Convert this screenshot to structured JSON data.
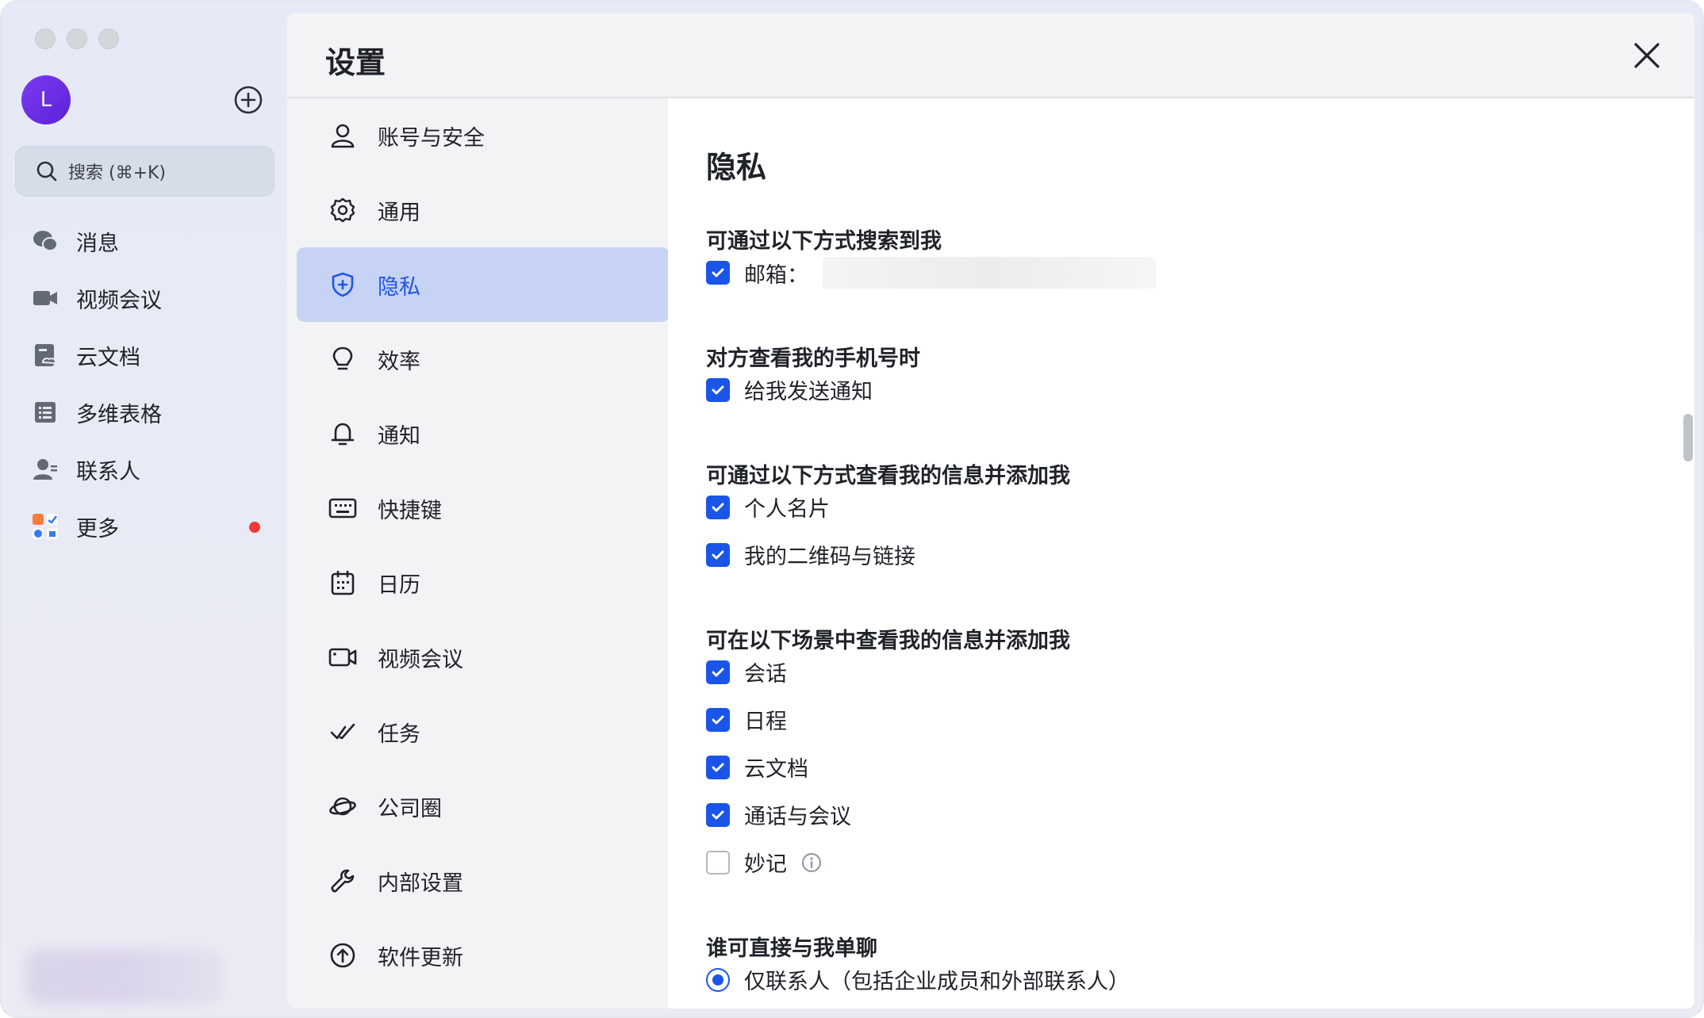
{
  "app": {
    "avatar_letter": "L",
    "search_placeholder": "搜索 (⌘+K)",
    "nav": [
      {
        "label": "消息",
        "icon": "chat-bubble-icon"
      },
      {
        "label": "视频会议",
        "icon": "video-camera-icon"
      },
      {
        "label": "云文档",
        "icon": "cloud-doc-icon"
      },
      {
        "label": "多维表格",
        "icon": "table-grid-icon"
      },
      {
        "label": "联系人",
        "icon": "contacts-icon"
      },
      {
        "label": "更多",
        "icon": "more-apps-icon"
      }
    ]
  },
  "settings": {
    "title": "设置",
    "menu": [
      {
        "label": "账号与安全",
        "icon": "user-icon"
      },
      {
        "label": "通用",
        "icon": "gear-icon"
      },
      {
        "label": "隐私",
        "icon": "shield-icon",
        "active": true
      },
      {
        "label": "效率",
        "icon": "lightbulb-icon"
      },
      {
        "label": "通知",
        "icon": "bell-icon"
      },
      {
        "label": "快捷键",
        "icon": "keyboard-icon"
      },
      {
        "label": "日历",
        "icon": "calendar-icon"
      },
      {
        "label": "视频会议",
        "icon": "video-camera-icon"
      },
      {
        "label": "任务",
        "icon": "checkmark-double-icon"
      },
      {
        "label": "公司圈",
        "icon": "planet-icon"
      },
      {
        "label": "内部设置",
        "icon": "wrench-icon"
      },
      {
        "label": "软件更新",
        "icon": "upload-arrow-icon"
      }
    ],
    "privacy": {
      "title": "隐私",
      "sections": {
        "search_me": {
          "title": "可通过以下方式搜索到我",
          "email_label": "邮箱："
        },
        "phone_view": {
          "title": "对方查看我的手机号时",
          "notify_label": "给我发送通知"
        },
        "add_by_method": {
          "title": "可通过以下方式查看我的信息并添加我",
          "items": [
            "个人名片",
            "我的二维码与链接"
          ]
        },
        "add_by_scene": {
          "title": "可在以下场景中查看我的信息并添加我",
          "items": [
            "会话",
            "日程",
            "云文档",
            "通话与会议",
            "妙记"
          ]
        },
        "direct_chat": {
          "title": "谁可直接与我单聊",
          "option": "仅联系人（包括企业成员和外部联系人）"
        }
      }
    }
  },
  "colors": {
    "accent": "#1a55e8",
    "active_menu_bg": "#c6d3f5",
    "notification_dot": "#f03a3a"
  }
}
